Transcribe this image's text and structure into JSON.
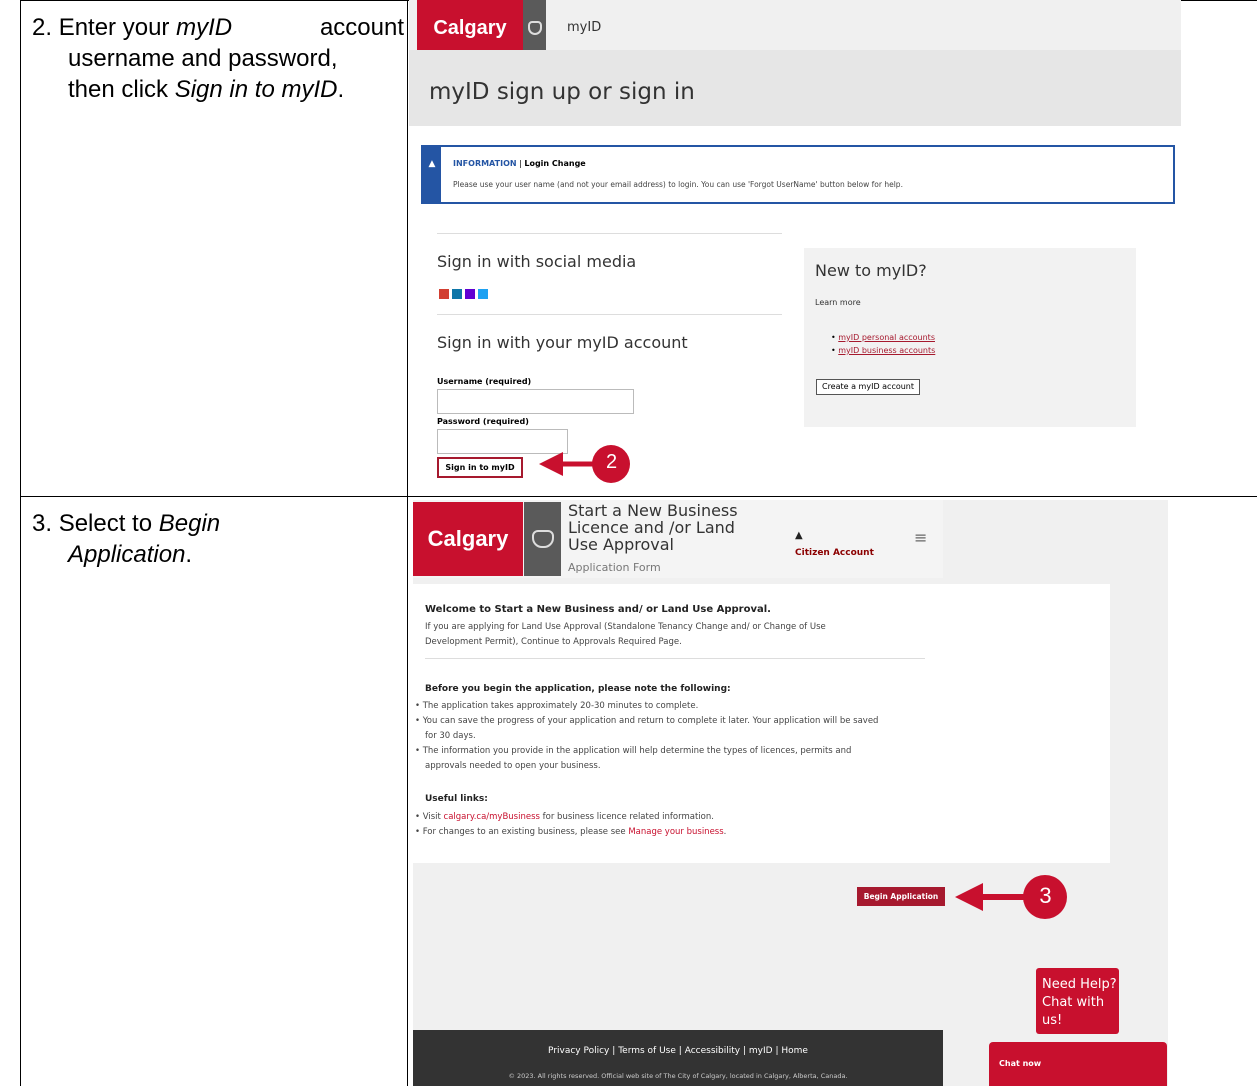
{
  "step2": {
    "row1_num": "2.",
    "row1_pre": "Enter your",
    "row1_em": "myID",
    "row1_post": "account",
    "row2": "username and password,",
    "row3_pre": "then click",
    "row3_em": "Sign in to myID",
    "row3_post": "."
  },
  "step3": {
    "row1_num": "3.",
    "row1_pre": "Select to",
    "row1_em": "Begin",
    "row2_em": "Application",
    "row2_post": "."
  },
  "signin": {
    "logo": "Calgary",
    "header_app": "myID",
    "page_title": "myID sign up or sign in",
    "info_label": "INFORMATION",
    "info_sep": "|",
    "info_title": "Login Change",
    "info_text": "Please use your user name (and not your email address) to login. You can use 'Forgot UserName' button below for help.",
    "social_heading": "Sign in with social media",
    "social_icons": [
      "google-icon",
      "linkedin-icon",
      "yahoo-icon",
      "microsoft-icon"
    ],
    "account_heading": "Sign in with your myID account",
    "username_label": "Username (required)",
    "password_label": "Password (required)",
    "signin_button": "Sign in to myID",
    "callout_number": "2",
    "new_heading": "New to myID?",
    "learn_more": "Learn more",
    "link_personal": "myID personal accounts",
    "link_business": "myID business accounts",
    "create_button": "Create a myID account"
  },
  "begin": {
    "logo": "Calgary",
    "header_title_1": "Start a New Business",
    "header_title_2": "Licence and /or Land",
    "header_title_3": "Use Approval",
    "header_subtitle": "Application Form",
    "citizen_account": "Citizen Account",
    "welcome_heading": "Welcome to Start a New Business and/ or Land Use Approval.",
    "welcome_text_1": "If you are applying for Land Use Approval (Standalone Tenancy Change and/ or Change of Use",
    "welcome_text_2": "Development Permit), Continue to Approvals Required Page.",
    "before_heading": "Before you begin the application, please note the following:",
    "bullet_1": "The application takes approximately 20-30 minutes to complete.",
    "bullet_2a": "You can save the progress of your application and return to complete it later. Your application will be saved",
    "bullet_2b": "for 30 days.",
    "bullet_3a": "The information you provide in the application will help determine the types of licences, permits and",
    "bullet_3b": "approvals needed to open your business.",
    "useful_heading": "Useful links:",
    "link1_pre": "Visit ",
    "link1": "calgary.ca/myBusiness",
    "link1_post": " for business licence related information.",
    "link2_pre": "For changes to an existing business, please see ",
    "link2": "Manage your business",
    "link2_post": ".",
    "begin_button": "Begin Application",
    "callout_number": "3",
    "footer_links": [
      "Privacy Policy",
      "Terms of Use",
      "Accessibility",
      "myID",
      "Home"
    ],
    "footer_sep": "|",
    "footer_copy": "© 2023. All rights reserved. Official web site of The City of Calgary, located in Calgary, Alberta, Canada.",
    "help_line1": "Need Help?",
    "help_line2": "Chat with us!",
    "chat_now": "Chat now"
  },
  "colors": {
    "brand_red": "#c8102e",
    "link_red": "#a6192e",
    "info_blue": "#2455a4",
    "footer_dark": "#333333"
  }
}
